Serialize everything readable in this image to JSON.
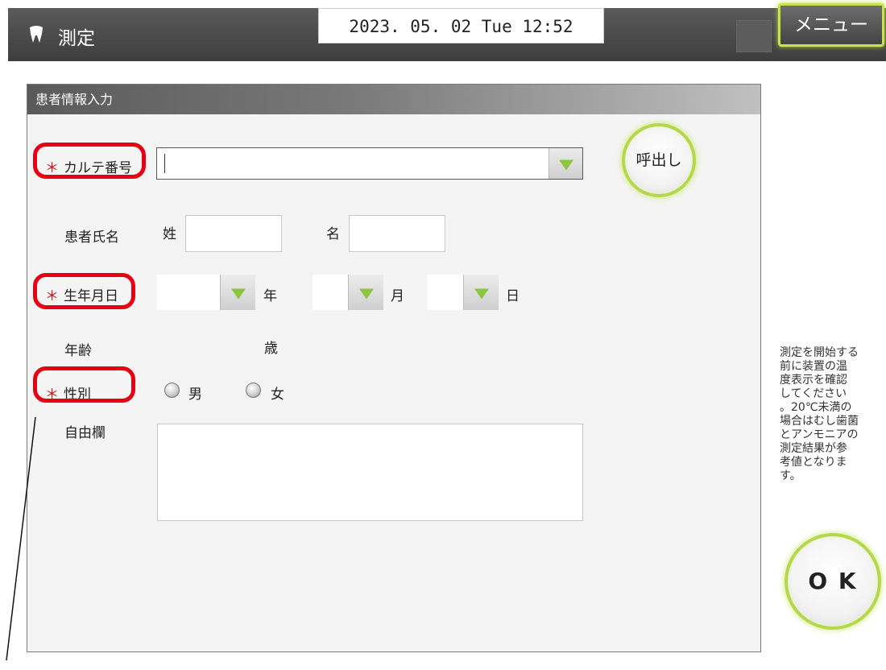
{
  "header": {
    "title": "測定",
    "datetime": "2023. 05. 02 Tue 12:52",
    "menu_label": "メニュー"
  },
  "panel": {
    "title": "患者情報入力"
  },
  "form": {
    "required_mark": "＊",
    "chart_number": {
      "label": "カルテ番号",
      "value": ""
    },
    "call_button": "呼出し",
    "name": {
      "label": "患者氏名",
      "last_label": "姓",
      "first_label": "名",
      "last_value": "",
      "first_value": ""
    },
    "birthdate": {
      "label": "生年月日",
      "year_unit": "年",
      "month_unit": "月",
      "day_unit": "日"
    },
    "age": {
      "label": "年齢",
      "unit": "歳"
    },
    "gender": {
      "label": "性別",
      "male": "男",
      "female": "女"
    },
    "free": {
      "label": "自由欄",
      "value": ""
    }
  },
  "side_note": "測定を開始する\n前に装置の温\n度表示を確認\nしてください\n。20℃未満の\n場合はむし歯菌\nとアンモニアの\n測定結果が参\n考値となりま\nす。",
  "ok_button": "O K",
  "colors": {
    "required_highlight": "#e60012",
    "accent_green": "#8cc63f"
  }
}
